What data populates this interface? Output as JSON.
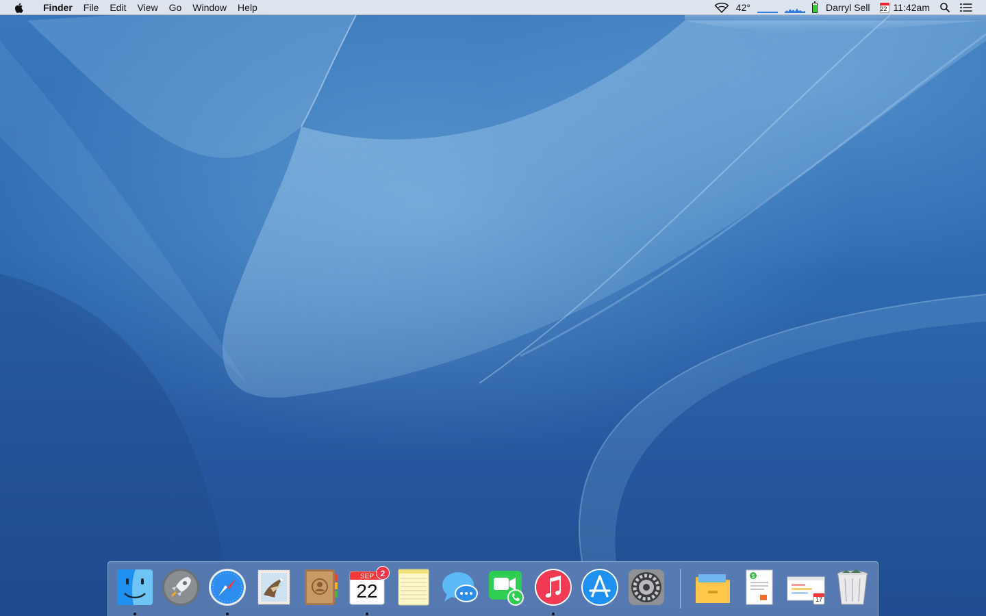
{
  "menubar": {
    "app_name": "Finder",
    "menus": [
      "File",
      "Edit",
      "View",
      "Go",
      "Window",
      "Help"
    ],
    "status": {
      "temperature": "42°",
      "user": "Darryl Sell",
      "calendar_day": "22",
      "time": "11:42am"
    }
  },
  "dock": {
    "apps": [
      {
        "name": "Finder",
        "icon": "finder-icon",
        "running": true
      },
      {
        "name": "Launchpad",
        "icon": "launchpad-icon",
        "running": false
      },
      {
        "name": "Safari",
        "icon": "safari-icon",
        "running": true
      },
      {
        "name": "Mail",
        "icon": "mail-icon",
        "running": false
      },
      {
        "name": "Contacts",
        "icon": "contacts-icon",
        "running": false
      },
      {
        "name": "Calendar",
        "icon": "calendar-icon",
        "running": true,
        "badge": "2",
        "month": "SEP",
        "day": "22"
      },
      {
        "name": "Notes",
        "icon": "notes-icon",
        "running": false
      },
      {
        "name": "Messages",
        "icon": "messages-icon",
        "running": false
      },
      {
        "name": "FaceTime",
        "icon": "facetime-icon",
        "running": false
      },
      {
        "name": "iTunes",
        "icon": "itunes-icon",
        "running": true
      },
      {
        "name": "App Store",
        "icon": "app-store-icon",
        "running": false
      },
      {
        "name": "System Preferences",
        "icon": "system-preferences-icon",
        "running": false
      }
    ],
    "stacks": [
      {
        "name": "Applications",
        "icon": "folder-stack-icon"
      },
      {
        "name": "Documents",
        "icon": "documents-stack-icon"
      },
      {
        "name": "Downloads",
        "icon": "downloads-stack-icon",
        "date": "17"
      },
      {
        "name": "Trash",
        "icon": "trash-icon"
      }
    ]
  },
  "colors": {
    "menubar_bg": "#eceef2",
    "wallpaper_top": "#3a78bd",
    "wallpaper_bottom": "#1f4c8f",
    "badge": "#f2334a"
  }
}
